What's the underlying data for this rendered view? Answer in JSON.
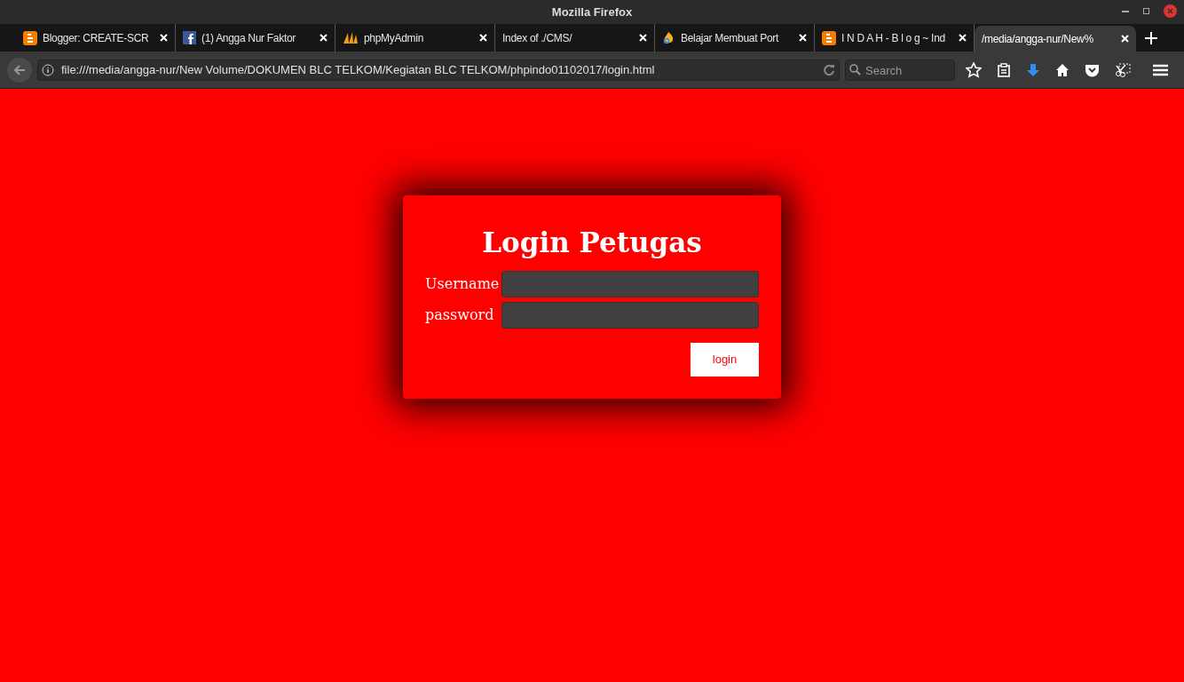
{
  "window": {
    "title": "Mozilla Firefox"
  },
  "tabs": [
    {
      "label": "Blogger: CREATE-SCR",
      "kind": "blogger",
      "selected": false
    },
    {
      "label": "(1) Angga Nur Faktor",
      "kind": "facebook",
      "selected": false
    },
    {
      "label": "phpMyAdmin",
      "kind": "pma",
      "selected": false
    },
    {
      "label": "Index of ./CMS/",
      "kind": "none",
      "selected": false
    },
    {
      "label": "Belajar Membuat Port",
      "kind": "flame",
      "selected": false
    },
    {
      "label": "I N D A H - B l o g ~ Ind",
      "kind": "blogger",
      "selected": false
    },
    {
      "label": "/media/angga-nur/New%",
      "kind": "none",
      "selected": true
    }
  ],
  "address": "file:///media/angga-nur/New Volume/DOKUMEN BLC TELKOM/Kegiatan BLC TELKOM/phpindo01102017/login.html",
  "search": {
    "placeholder": "Search"
  },
  "login": {
    "title": "Login Petugas",
    "fields": [
      {
        "label": "Username"
      },
      {
        "label": "password"
      }
    ],
    "button": "login"
  }
}
